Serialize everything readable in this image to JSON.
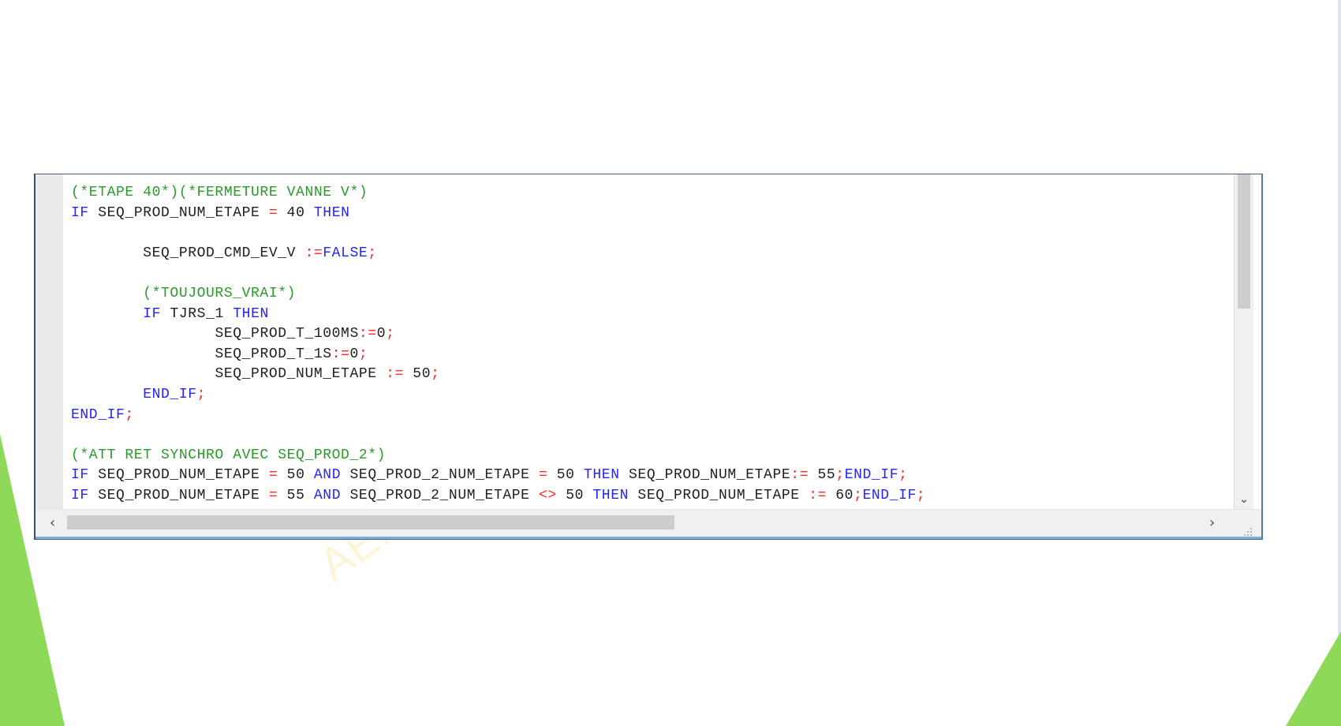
{
  "colors": {
    "keyword": "#2424FF",
    "operator": "#FF2A2A",
    "identifier": "#202020",
    "comment": "#2A9A2A",
    "background": "#FFFFFF",
    "gutter": "#EAEAEA",
    "accent_green": "#8ED957",
    "scrollbar_track": "#F0F0F0",
    "scrollbar_thumb": "#CDCDCD",
    "window_border": "#4F7FA9"
  },
  "watermark": "AEI",
  "editor": {
    "code_lines": [
      {
        "kind": "comment",
        "text": "(*ETAPE 40*)(*FERMETURE VANNE V*)"
      },
      {
        "kind": "code",
        "tokens": [
          {
            "type": "keyword",
            "text": "IF"
          },
          {
            "type": "space",
            "text": " "
          },
          {
            "type": "identifier",
            "text": "SEQ_PROD_NUM_ETAPE"
          },
          {
            "type": "space",
            "text": " "
          },
          {
            "type": "operator",
            "text": "="
          },
          {
            "type": "space",
            "text": " "
          },
          {
            "type": "number",
            "text": "40"
          },
          {
            "type": "space",
            "text": " "
          },
          {
            "type": "keyword",
            "text": "THEN"
          }
        ]
      },
      {
        "kind": "blank",
        "text": ""
      },
      {
        "kind": "code",
        "tokens": [
          {
            "type": "space",
            "text": "        "
          },
          {
            "type": "identifier",
            "text": "SEQ_PROD_CMD_EV_V"
          },
          {
            "type": "space",
            "text": " "
          },
          {
            "type": "operator",
            "text": ":="
          },
          {
            "type": "keyword",
            "text": "FALSE"
          },
          {
            "type": "operator",
            "text": ";"
          }
        ]
      },
      {
        "kind": "blank",
        "text": ""
      },
      {
        "kind": "comment",
        "text": "        (*TOUJOURS_VRAI*)"
      },
      {
        "kind": "code",
        "tokens": [
          {
            "type": "space",
            "text": "        "
          },
          {
            "type": "keyword",
            "text": "IF"
          },
          {
            "type": "space",
            "text": " "
          },
          {
            "type": "identifier",
            "text": "TJRS_1"
          },
          {
            "type": "space",
            "text": " "
          },
          {
            "type": "keyword",
            "text": "THEN"
          }
        ]
      },
      {
        "kind": "code",
        "tokens": [
          {
            "type": "space",
            "text": "                "
          },
          {
            "type": "identifier",
            "text": "SEQ_PROD_T_100MS"
          },
          {
            "type": "operator",
            "text": ":="
          },
          {
            "type": "number",
            "text": "0"
          },
          {
            "type": "operator",
            "text": ";"
          }
        ]
      },
      {
        "kind": "code",
        "tokens": [
          {
            "type": "space",
            "text": "                "
          },
          {
            "type": "identifier",
            "text": "SEQ_PROD_T_1S"
          },
          {
            "type": "operator",
            "text": ":="
          },
          {
            "type": "number",
            "text": "0"
          },
          {
            "type": "operator",
            "text": ";"
          }
        ]
      },
      {
        "kind": "code",
        "tokens": [
          {
            "type": "space",
            "text": "                "
          },
          {
            "type": "identifier",
            "text": "SEQ_PROD_NUM_ETAPE"
          },
          {
            "type": "space",
            "text": " "
          },
          {
            "type": "operator",
            "text": ":="
          },
          {
            "type": "space",
            "text": " "
          },
          {
            "type": "number",
            "text": "50"
          },
          {
            "type": "operator",
            "text": ";"
          }
        ]
      },
      {
        "kind": "code",
        "tokens": [
          {
            "type": "space",
            "text": "        "
          },
          {
            "type": "keyword",
            "text": "END_IF"
          },
          {
            "type": "operator",
            "text": ";"
          }
        ]
      },
      {
        "kind": "code",
        "tokens": [
          {
            "type": "keyword",
            "text": "END_IF"
          },
          {
            "type": "operator",
            "text": ";"
          }
        ]
      },
      {
        "kind": "blank",
        "text": ""
      },
      {
        "kind": "comment",
        "text": "(*ATT RET SYNCHRO AVEC SEQ_PROD_2*)"
      },
      {
        "kind": "code",
        "tokens": [
          {
            "type": "keyword",
            "text": "IF"
          },
          {
            "type": "space",
            "text": " "
          },
          {
            "type": "identifier",
            "text": "SEQ_PROD_NUM_ETAPE"
          },
          {
            "type": "space",
            "text": " "
          },
          {
            "type": "operator",
            "text": "="
          },
          {
            "type": "space",
            "text": " "
          },
          {
            "type": "number",
            "text": "50"
          },
          {
            "type": "space",
            "text": " "
          },
          {
            "type": "keyword",
            "text": "AND"
          },
          {
            "type": "space",
            "text": " "
          },
          {
            "type": "identifier",
            "text": "SEQ_PROD_2_NUM_ETAPE"
          },
          {
            "type": "space",
            "text": " "
          },
          {
            "type": "operator",
            "text": "="
          },
          {
            "type": "space",
            "text": " "
          },
          {
            "type": "number",
            "text": "50"
          },
          {
            "type": "space",
            "text": " "
          },
          {
            "type": "keyword",
            "text": "THEN"
          },
          {
            "type": "space",
            "text": " "
          },
          {
            "type": "identifier",
            "text": "SEQ_PROD_NUM_ETAPE"
          },
          {
            "type": "operator",
            "text": ":="
          },
          {
            "type": "space",
            "text": " "
          },
          {
            "type": "number",
            "text": "55"
          },
          {
            "type": "operator",
            "text": ";"
          },
          {
            "type": "keyword",
            "text": "END_IF"
          },
          {
            "type": "operator",
            "text": ";"
          }
        ]
      },
      {
        "kind": "code",
        "tokens": [
          {
            "type": "keyword",
            "text": "IF"
          },
          {
            "type": "space",
            "text": " "
          },
          {
            "type": "identifier",
            "text": "SEQ_PROD_NUM_ETAPE"
          },
          {
            "type": "space",
            "text": " "
          },
          {
            "type": "operator",
            "text": "="
          },
          {
            "type": "space",
            "text": " "
          },
          {
            "type": "number",
            "text": "55"
          },
          {
            "type": "space",
            "text": " "
          },
          {
            "type": "keyword",
            "text": "AND"
          },
          {
            "type": "space",
            "text": " "
          },
          {
            "type": "identifier",
            "text": "SEQ_PROD_2_NUM_ETAPE"
          },
          {
            "type": "space",
            "text": " "
          },
          {
            "type": "operator",
            "text": "<>"
          },
          {
            "type": "space",
            "text": " "
          },
          {
            "type": "number",
            "text": "50"
          },
          {
            "type": "space",
            "text": " "
          },
          {
            "type": "keyword",
            "text": "THEN"
          },
          {
            "type": "space",
            "text": " "
          },
          {
            "type": "identifier",
            "text": "SEQ_PROD_NUM_ETAPE"
          },
          {
            "type": "space",
            "text": " "
          },
          {
            "type": "operator",
            "text": ":="
          },
          {
            "type": "space",
            "text": " "
          },
          {
            "type": "number",
            "text": "60"
          },
          {
            "type": "operator",
            "text": ";"
          },
          {
            "type": "keyword",
            "text": "END_IF"
          },
          {
            "type": "operator",
            "text": ";"
          }
        ]
      }
    ],
    "scroll_down_icon": "chevron-down-icon",
    "scroll_left_icon": "chevron-left-icon",
    "scroll_right_icon": "chevron-right-icon",
    "resize_icon": "resize-grip-icon"
  }
}
